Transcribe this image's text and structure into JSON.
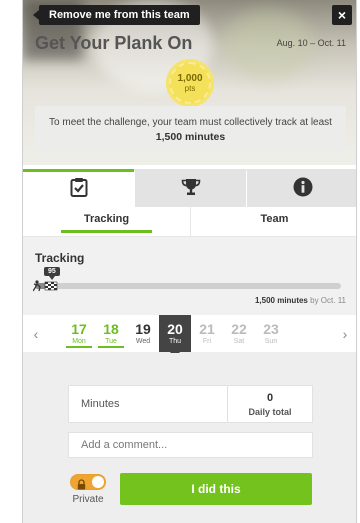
{
  "hero": {
    "leave_tooltip": "Remove me from this team",
    "close_label": "×",
    "title": "Get Your Plank On",
    "dates": "Aug. 10 – Oct. 11",
    "points_value": "1,000",
    "points_unit": "pts",
    "goal_text": "To meet the challenge, your team must collectively track at least",
    "goal_target": "1,500 minutes"
  },
  "tabs": {
    "icons": [
      "clipboard-check-icon",
      "trophy-icon",
      "info-icon"
    ],
    "active_index": 0,
    "sub": [
      {
        "label": "Tracking",
        "active": true
      },
      {
        "label": "Team",
        "active": false
      }
    ]
  },
  "tracking": {
    "label": "Tracking",
    "bubble_value": "95",
    "progress_fraction": 0.063,
    "goal_amount": "1,500 minutes",
    "goal_by": "by Oct. 11"
  },
  "days": {
    "prev_label": "‹",
    "next_label": "›",
    "items": [
      {
        "date": "17",
        "weekday": "Mon",
        "state": "done"
      },
      {
        "date": "18",
        "weekday": "Tue",
        "state": "done"
      },
      {
        "date": "19",
        "weekday": "Wed",
        "state": "plain"
      },
      {
        "date": "20",
        "weekday": "Thu",
        "state": "today"
      },
      {
        "date": "21",
        "weekday": "Fri",
        "state": "future"
      },
      {
        "date": "22",
        "weekday": "Sat",
        "state": "future"
      },
      {
        "date": "23",
        "weekday": "Sun",
        "state": "future"
      }
    ]
  },
  "entry": {
    "minutes_placeholder": "Minutes",
    "daily_total_value": "0",
    "daily_total_label": "Daily total",
    "comment_placeholder": "Add a comment...",
    "private_label": "Private",
    "submit_label": "I did this"
  },
  "colors": {
    "accent_green": "#74c21e",
    "toggle_orange": "#f0a533"
  }
}
